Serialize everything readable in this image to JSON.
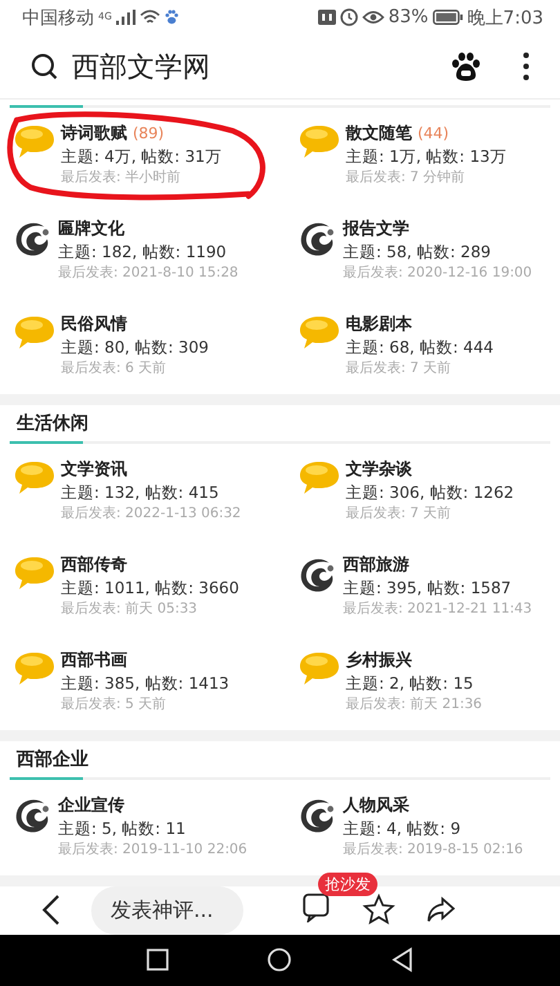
{
  "status_bar": {
    "carrier": "中国移动",
    "network": "4G",
    "battery": "83%",
    "time": "晚上7:03"
  },
  "header": {
    "title": "西部文学网"
  },
  "sections": [
    {
      "forums": [
        {
          "kind": "bubble",
          "name": "诗词歌赋",
          "count": "(89)",
          "stats": "主题: 4万, 帖数: 31万",
          "last": "最后发表: 半小时前",
          "circled": true
        },
        {
          "kind": "bubble",
          "name": "散文随笔",
          "count": "(44)",
          "stats": "主题: 1万, 帖数: 13万",
          "last": "最后发表: 7 分钟前",
          "circled": false
        },
        {
          "kind": "logo",
          "name": "匾牌文化",
          "stats": "主题: 182, 帖数: 1190",
          "last": "最后发表: 2021-8-10 15:28",
          "circled": false
        },
        {
          "kind": "logo",
          "name": "报告文学",
          "stats": "主题: 58, 帖数: 289",
          "last": "最后发表: 2020-12-16 19:00",
          "circled": false
        },
        {
          "kind": "bubble",
          "name": "民俗风情",
          "stats": "主题: 80, 帖数: 309",
          "last": "最后发表: 6 天前",
          "circled": false
        },
        {
          "kind": "bubble",
          "name": "电影剧本",
          "stats": "主题: 68, 帖数: 444",
          "last": "最后发表: 7 天前",
          "circled": false
        }
      ]
    },
    {
      "title": "生活休闲",
      "forums": [
        {
          "kind": "bubble",
          "name": "文学资讯",
          "stats": "主题: 132, 帖数: 415",
          "last": "最后发表: 2022-1-13 06:32",
          "circled": false
        },
        {
          "kind": "bubble",
          "name": "文学杂谈",
          "stats": "主题: 306, 帖数: 1262",
          "last": "最后发表: 7 天前",
          "circled": false
        },
        {
          "kind": "bubble",
          "name": "西部传奇",
          "stats": "主题: 1011, 帖数: 3660",
          "last": "最后发表: 前天 05:33",
          "circled": false
        },
        {
          "kind": "logo",
          "name": "西部旅游",
          "stats": "主题: 395, 帖数: 1587",
          "last": "最后发表: 2021-12-21 11:43",
          "circled": false
        },
        {
          "kind": "bubble",
          "name": "西部书画",
          "stats": "主题: 385, 帖数: 1413",
          "last": "最后发表: 5 天前",
          "circled": false
        },
        {
          "kind": "bubble",
          "name": "乡村振兴",
          "stats": "主题: 2, 帖数: 15",
          "last": "最后发表: 前天 21:36",
          "circled": false
        }
      ]
    },
    {
      "title": "西部企业",
      "forums": [
        {
          "kind": "logo",
          "name": "企业宣传",
          "stats": "主题: 5, 帖数: 11",
          "last": "最后发表: 2019-11-10 22:06",
          "circled": false
        },
        {
          "kind": "logo",
          "name": "人物风采",
          "stats": "主题: 4, 帖数: 9",
          "last": "最后发表: 2019-8-15 02:16",
          "circled": false
        }
      ]
    }
  ],
  "bottom_bar": {
    "comment_placeholder": "发表神评...",
    "comment_badge": "抢沙发"
  }
}
